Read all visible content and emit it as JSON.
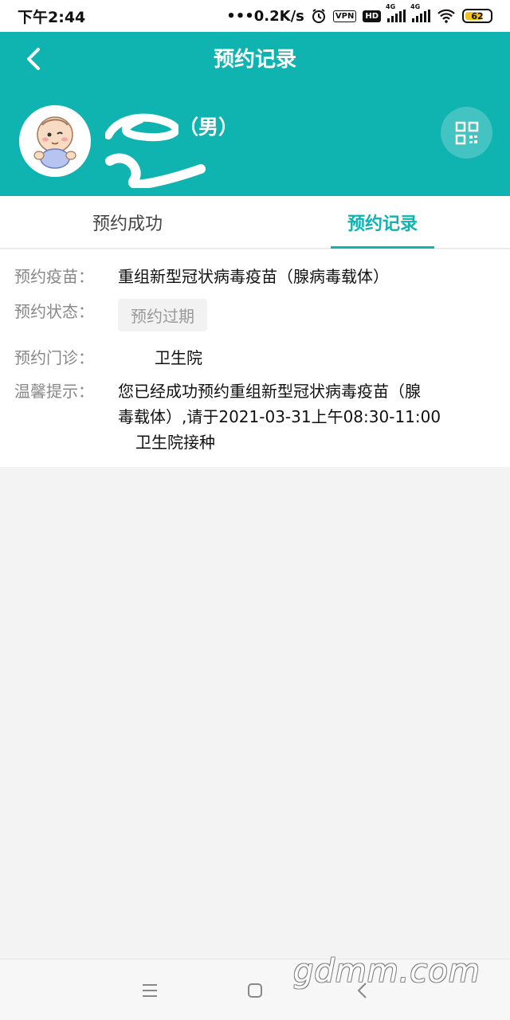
{
  "status_bar": {
    "time": "下午2:44",
    "network_speed": "0.2K/s",
    "vpn": "VPN",
    "hd": "HD",
    "sim1": "4G",
    "sim2": "4G",
    "battery": "62"
  },
  "header": {
    "title": "预约记录",
    "gender": "（男）"
  },
  "tabs": [
    {
      "label": "预约成功",
      "active": false
    },
    {
      "label": "预约记录",
      "active": true
    }
  ],
  "record": {
    "vaccine_label": "预约疫苗：",
    "vaccine_value": "重组新型冠状病毒疫苗（腺病毒载体）",
    "status_label": "预约状态：",
    "status_value": "预约过期",
    "clinic_label": "预约门诊：",
    "clinic_value": "卫生院",
    "tip_label": "温馨提示：",
    "tip_line1": "您已经成功预约重组新型冠状病毒疫苗（腺",
    "tip_line2": "毒载体）,请于2021-03-31上午08:30-11:00",
    "tip_line3": "卫生院接种"
  },
  "watermark": "gdmm.com",
  "icons": {
    "back": "back-arrow-icon",
    "qr": "qr-code-icon",
    "menu": "menu-icon",
    "home": "home-icon",
    "nav_back": "nav-back-icon"
  },
  "colors": {
    "primary": "#0fb3b0",
    "background": "#f3f3f3"
  }
}
